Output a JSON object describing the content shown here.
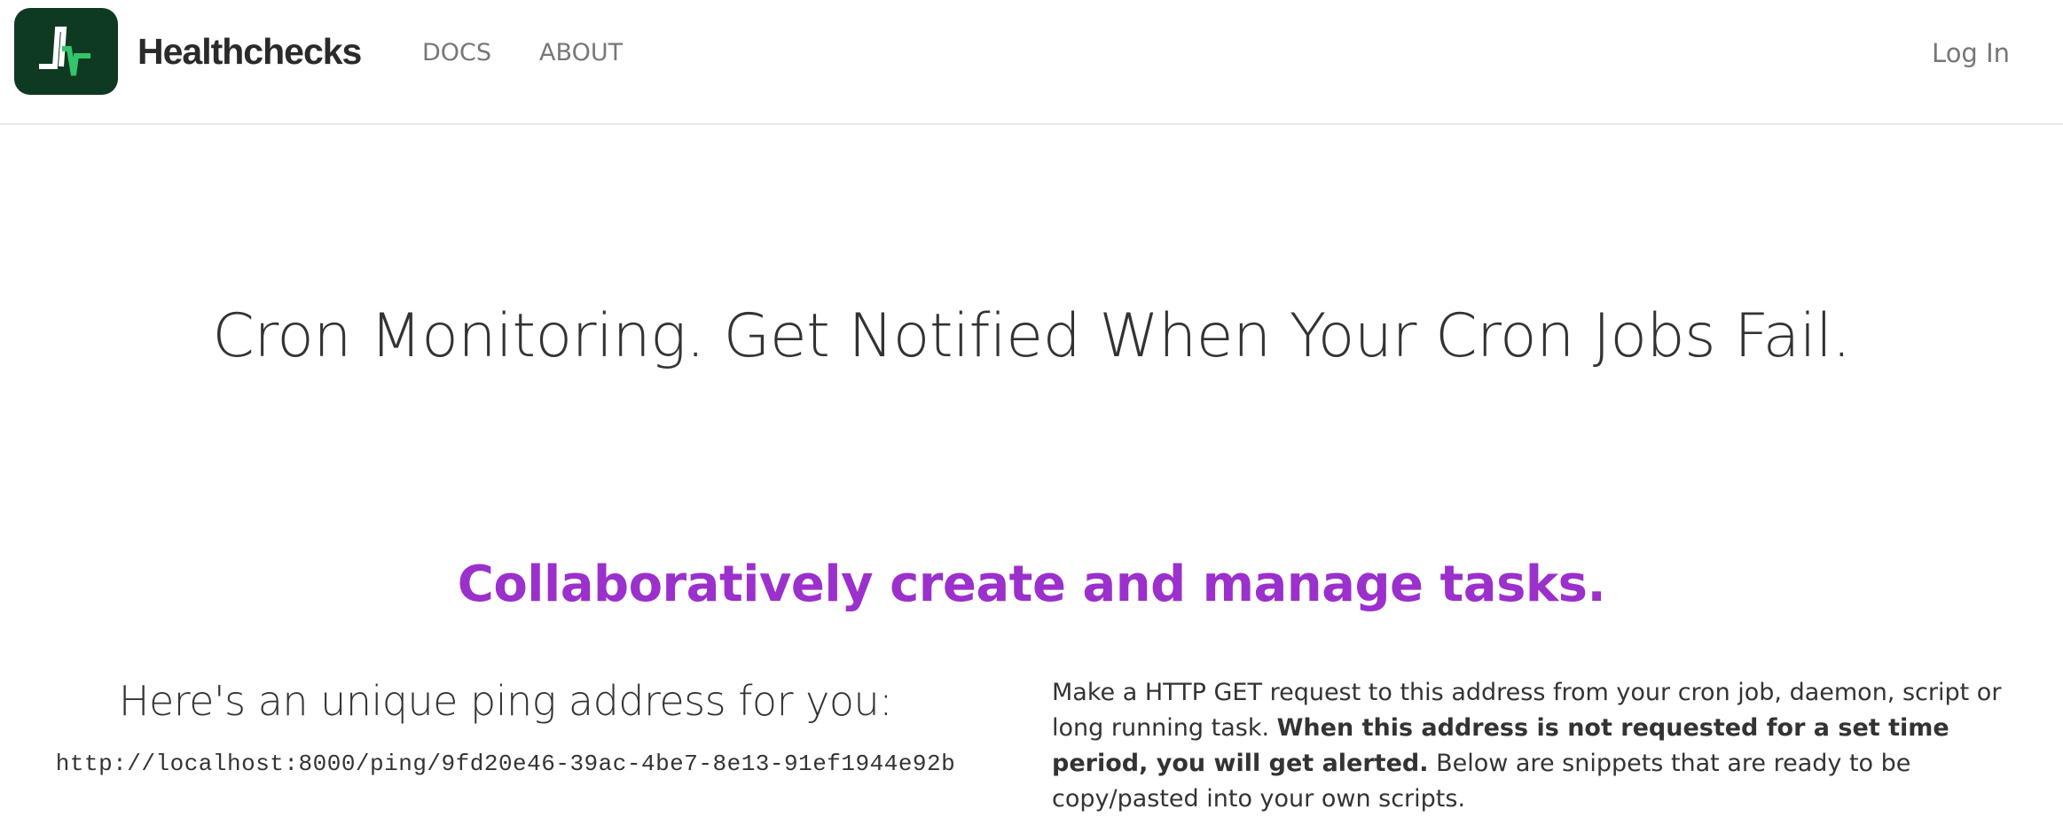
{
  "brand": {
    "name": "Healthchecks",
    "logo_icon": "pulse-icon",
    "logo_bg": "#0f3a22",
    "logo_accent": "#34c46a"
  },
  "nav": {
    "docs": "DOCS",
    "about": "ABOUT",
    "login": "Log In"
  },
  "hero": {
    "title": "Cron Monitoring. Get Notified When Your Cron Jobs Fail.",
    "tagline": "Collaboratively create and manage tasks.",
    "tagline_color": "#9b30cc"
  },
  "ping": {
    "heading": "Here's an unique ping address for you:",
    "url": "http://localhost:8000/ping/9fd20e46-39ac-4be7-8e13-91ef1944e92b",
    "desc_part1": "Make a HTTP GET request to this address from your cron job, daemon, script or long running task. ",
    "desc_bold": "When this address is not requested for a set time period, you will get alerted.",
    "desc_part2": " Below are snippets that are ready to be copy/pasted into your own scripts."
  }
}
